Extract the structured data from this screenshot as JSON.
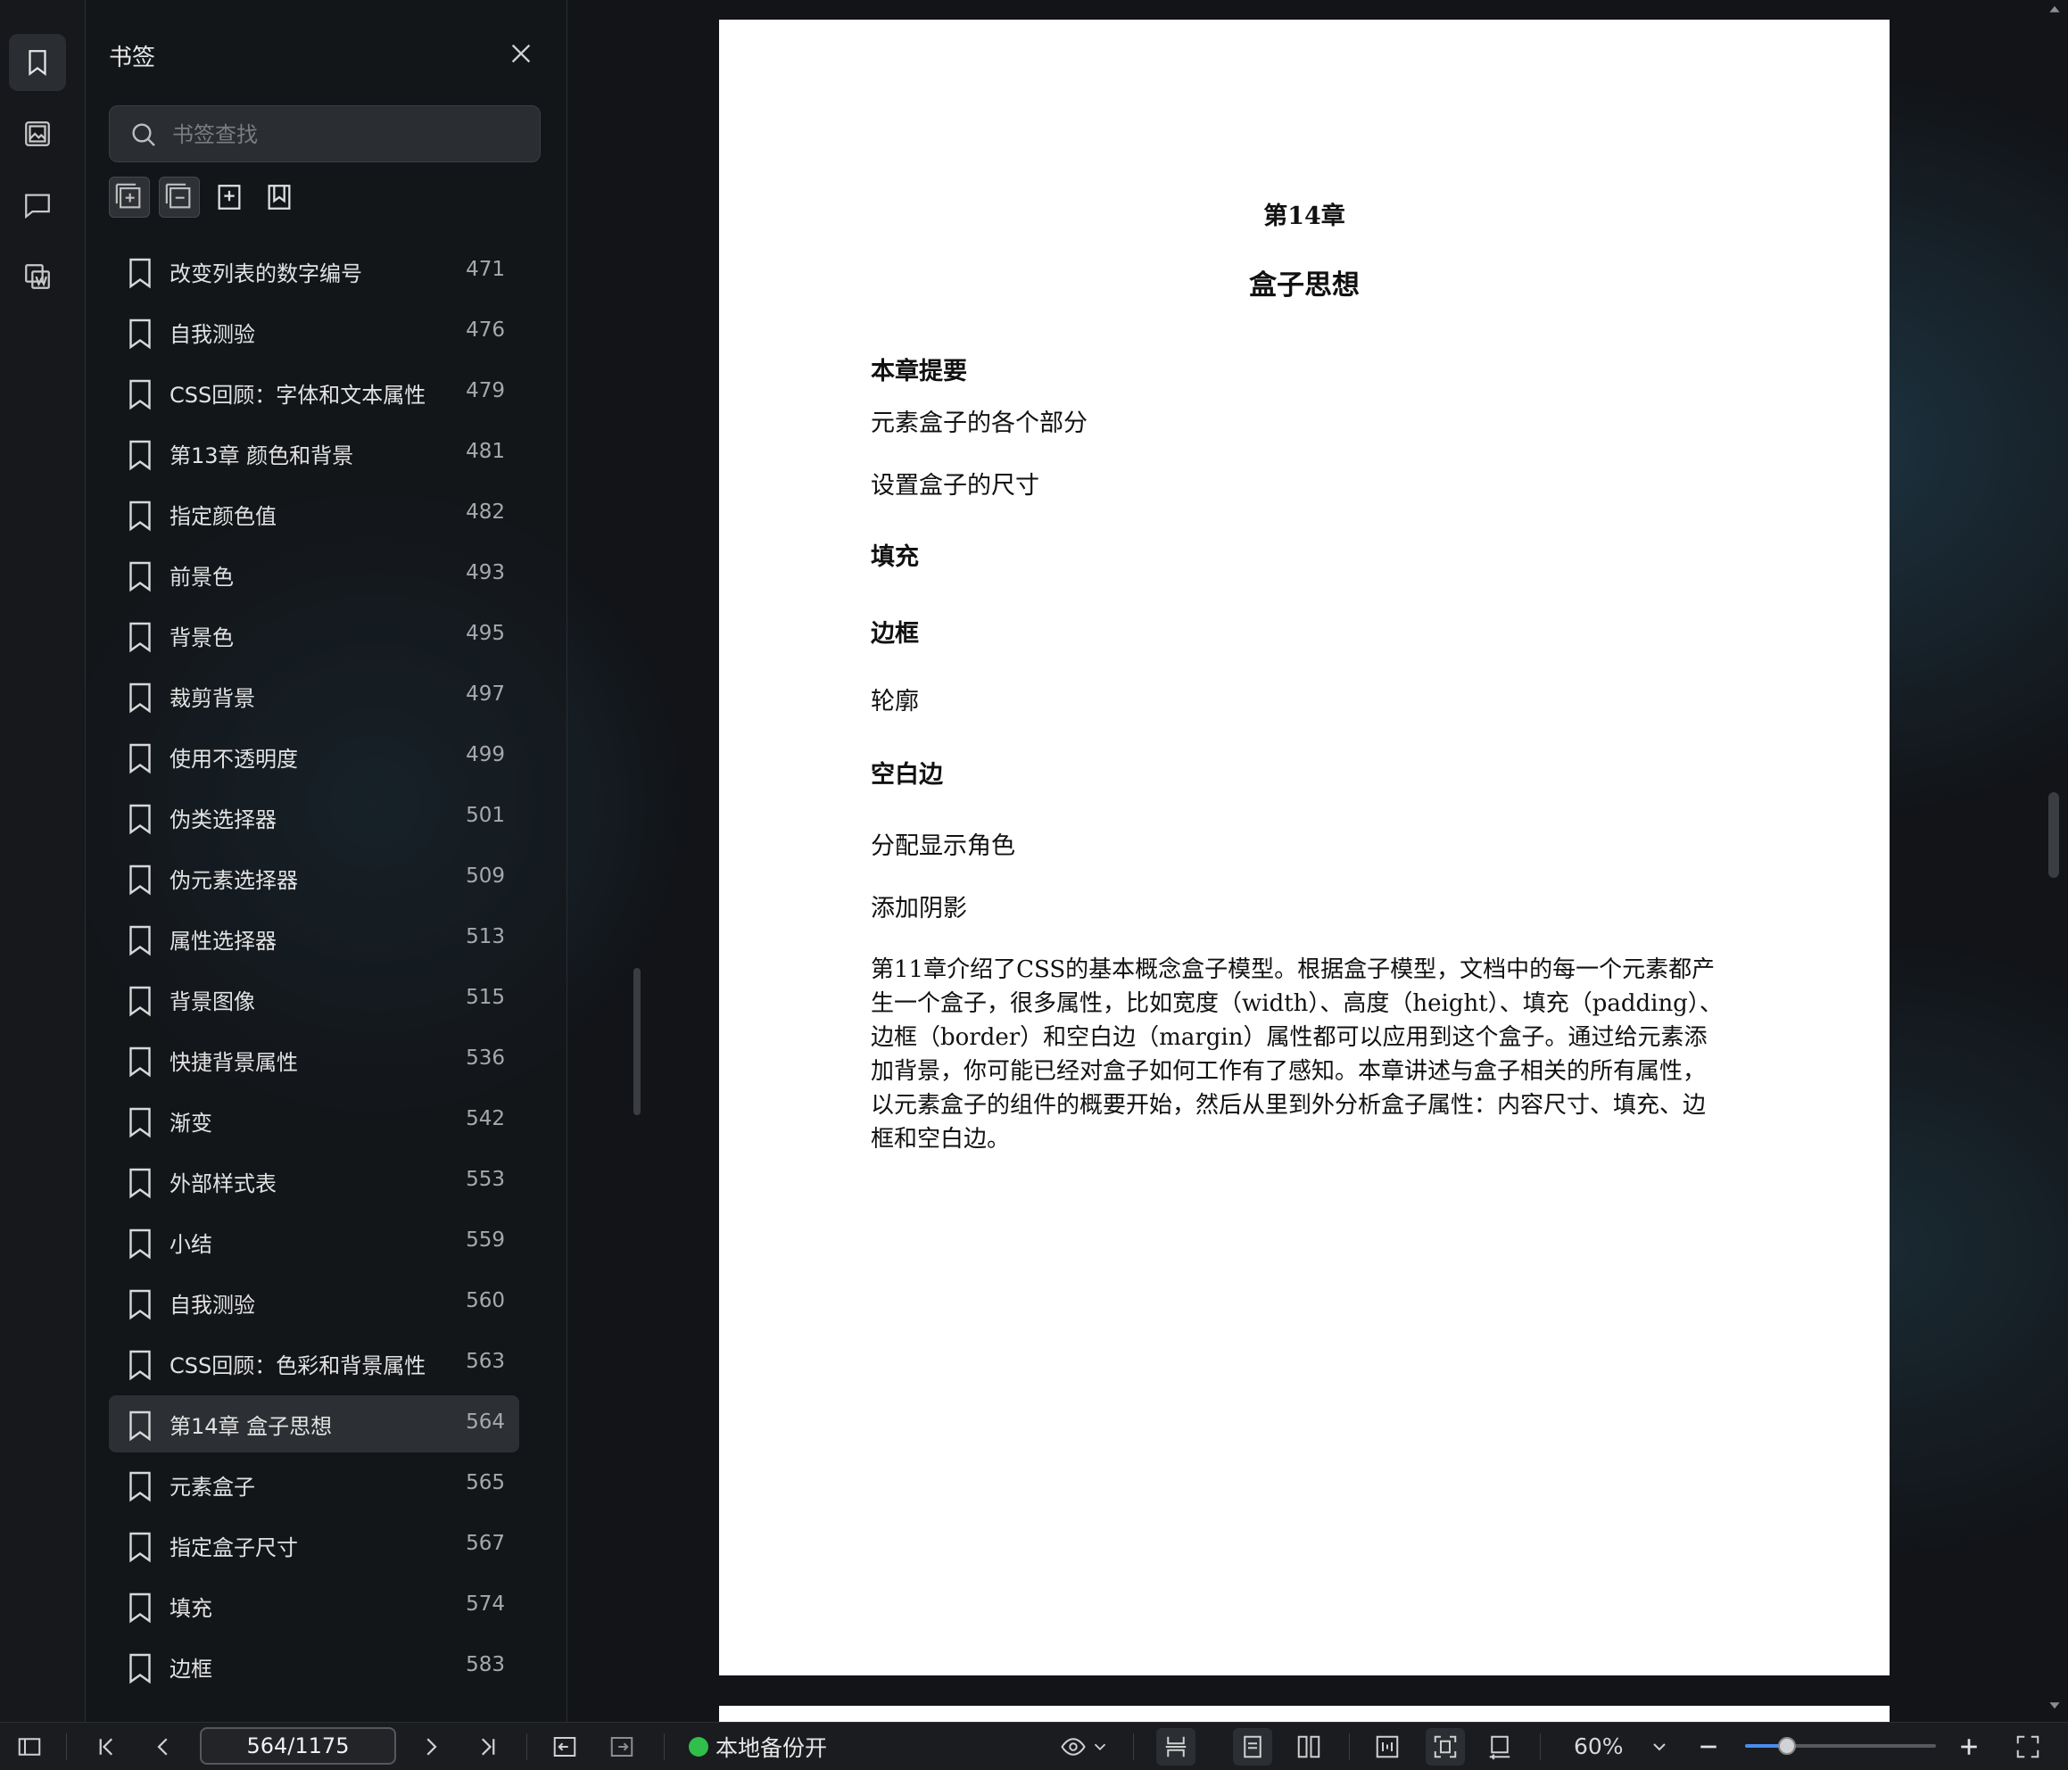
{
  "sidebar": {
    "title": "书签",
    "search_placeholder": "书签查找",
    "items": [
      {
        "label": "改变列表的数字编号",
        "page": "471"
      },
      {
        "label": "自我测验",
        "page": "476"
      },
      {
        "label": "CSS回顾：字体和文本属性",
        "page": "479"
      },
      {
        "label": "第13章 颜色和背景",
        "page": "481"
      },
      {
        "label": "指定颜色值",
        "page": "482"
      },
      {
        "label": "前景色",
        "page": "493"
      },
      {
        "label": "背景色",
        "page": "495"
      },
      {
        "label": "裁剪背景",
        "page": "497"
      },
      {
        "label": "使用不透明度",
        "page": "499"
      },
      {
        "label": "伪类选择器",
        "page": "501"
      },
      {
        "label": "伪元素选择器",
        "page": "509"
      },
      {
        "label": "属性选择器",
        "page": "513"
      },
      {
        "label": "背景图像",
        "page": "515"
      },
      {
        "label": "快捷背景属性",
        "page": "536"
      },
      {
        "label": "渐变",
        "page": "542"
      },
      {
        "label": "外部样式表",
        "page": "553"
      },
      {
        "label": "小结",
        "page": "559"
      },
      {
        "label": "自我测验",
        "page": "560"
      },
      {
        "label": "CSS回顾：色彩和背景属性",
        "page": "563"
      },
      {
        "label": "第14章 盒子思想",
        "page": "564"
      },
      {
        "label": "元素盒子",
        "page": "565"
      },
      {
        "label": "指定盒子尺寸",
        "page": "567"
      },
      {
        "label": "填充",
        "page": "574"
      },
      {
        "label": "边框",
        "page": "583"
      }
    ],
    "selected_index": 19
  },
  "document": {
    "chapter": "第14章",
    "title": "盒子思想",
    "summary_heading": "本章提要",
    "lines": [
      {
        "text": "元素盒子的各个部分",
        "bold": false
      },
      {
        "text": "设置盒子的尺寸",
        "bold": false
      },
      {
        "text": "填充",
        "bold": true
      },
      {
        "text": "边框",
        "bold": true
      },
      {
        "text": "轮廓",
        "bold": false
      },
      {
        "text": "空白边",
        "bold": true
      },
      {
        "text": "分配显示角色",
        "bold": false
      },
      {
        "text": "添加阴影",
        "bold": false
      }
    ],
    "paragraph": "第11章介绍了CSS的基本概念盒子模型。根据盒子模型，文档中的每一个元素都产生一个盒子，很多属性，比如宽度（width）、高度（height）、填充（padding）、边框（border）和空白边（margin）属性都可以应用到这个盒子。通过给元素添加背景，你可能已经对盒子如何工作有了感知。本章讲述与盒子相关的所有属性，以元素盒子的组件的概要开始，然后从里到外分析盒子属性：内容尺寸、填充、边框和空白边。"
  },
  "bottombar": {
    "page_field": "564/1175",
    "backup_label": "本地备份开",
    "zoom": "60%",
    "zoom_fraction": 0.22,
    "backup_status_color": "#2fbf4a"
  }
}
